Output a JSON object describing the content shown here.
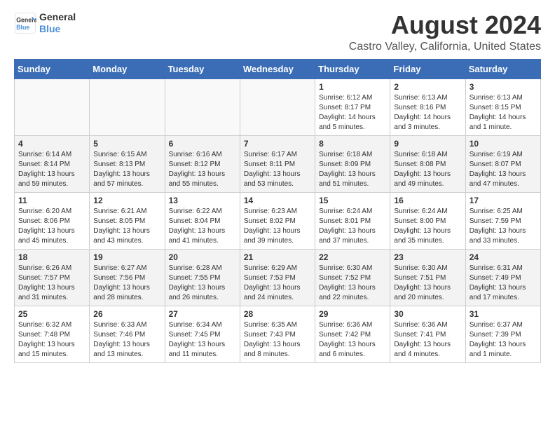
{
  "logo": {
    "line1": "General",
    "line2": "Blue"
  },
  "title": "August 2024",
  "location": "Castro Valley, California, United States",
  "weekdays": [
    "Sunday",
    "Monday",
    "Tuesday",
    "Wednesday",
    "Thursday",
    "Friday",
    "Saturday"
  ],
  "weeks": [
    [
      {
        "day": "",
        "info": ""
      },
      {
        "day": "",
        "info": ""
      },
      {
        "day": "",
        "info": ""
      },
      {
        "day": "",
        "info": ""
      },
      {
        "day": "1",
        "info": "Sunrise: 6:12 AM\nSunset: 8:17 PM\nDaylight: 14 hours\nand 5 minutes."
      },
      {
        "day": "2",
        "info": "Sunrise: 6:13 AM\nSunset: 8:16 PM\nDaylight: 14 hours\nand 3 minutes."
      },
      {
        "day": "3",
        "info": "Sunrise: 6:13 AM\nSunset: 8:15 PM\nDaylight: 14 hours\nand 1 minute."
      }
    ],
    [
      {
        "day": "4",
        "info": "Sunrise: 6:14 AM\nSunset: 8:14 PM\nDaylight: 13 hours\nand 59 minutes."
      },
      {
        "day": "5",
        "info": "Sunrise: 6:15 AM\nSunset: 8:13 PM\nDaylight: 13 hours\nand 57 minutes."
      },
      {
        "day": "6",
        "info": "Sunrise: 6:16 AM\nSunset: 8:12 PM\nDaylight: 13 hours\nand 55 minutes."
      },
      {
        "day": "7",
        "info": "Sunrise: 6:17 AM\nSunset: 8:11 PM\nDaylight: 13 hours\nand 53 minutes."
      },
      {
        "day": "8",
        "info": "Sunrise: 6:18 AM\nSunset: 8:09 PM\nDaylight: 13 hours\nand 51 minutes."
      },
      {
        "day": "9",
        "info": "Sunrise: 6:18 AM\nSunset: 8:08 PM\nDaylight: 13 hours\nand 49 minutes."
      },
      {
        "day": "10",
        "info": "Sunrise: 6:19 AM\nSunset: 8:07 PM\nDaylight: 13 hours\nand 47 minutes."
      }
    ],
    [
      {
        "day": "11",
        "info": "Sunrise: 6:20 AM\nSunset: 8:06 PM\nDaylight: 13 hours\nand 45 minutes."
      },
      {
        "day": "12",
        "info": "Sunrise: 6:21 AM\nSunset: 8:05 PM\nDaylight: 13 hours\nand 43 minutes."
      },
      {
        "day": "13",
        "info": "Sunrise: 6:22 AM\nSunset: 8:04 PM\nDaylight: 13 hours\nand 41 minutes."
      },
      {
        "day": "14",
        "info": "Sunrise: 6:23 AM\nSunset: 8:02 PM\nDaylight: 13 hours\nand 39 minutes."
      },
      {
        "day": "15",
        "info": "Sunrise: 6:24 AM\nSunset: 8:01 PM\nDaylight: 13 hours\nand 37 minutes."
      },
      {
        "day": "16",
        "info": "Sunrise: 6:24 AM\nSunset: 8:00 PM\nDaylight: 13 hours\nand 35 minutes."
      },
      {
        "day": "17",
        "info": "Sunrise: 6:25 AM\nSunset: 7:59 PM\nDaylight: 13 hours\nand 33 minutes."
      }
    ],
    [
      {
        "day": "18",
        "info": "Sunrise: 6:26 AM\nSunset: 7:57 PM\nDaylight: 13 hours\nand 31 minutes."
      },
      {
        "day": "19",
        "info": "Sunrise: 6:27 AM\nSunset: 7:56 PM\nDaylight: 13 hours\nand 28 minutes."
      },
      {
        "day": "20",
        "info": "Sunrise: 6:28 AM\nSunset: 7:55 PM\nDaylight: 13 hours\nand 26 minutes."
      },
      {
        "day": "21",
        "info": "Sunrise: 6:29 AM\nSunset: 7:53 PM\nDaylight: 13 hours\nand 24 minutes."
      },
      {
        "day": "22",
        "info": "Sunrise: 6:30 AM\nSunset: 7:52 PM\nDaylight: 13 hours\nand 22 minutes."
      },
      {
        "day": "23",
        "info": "Sunrise: 6:30 AM\nSunset: 7:51 PM\nDaylight: 13 hours\nand 20 minutes."
      },
      {
        "day": "24",
        "info": "Sunrise: 6:31 AM\nSunset: 7:49 PM\nDaylight: 13 hours\nand 17 minutes."
      }
    ],
    [
      {
        "day": "25",
        "info": "Sunrise: 6:32 AM\nSunset: 7:48 PM\nDaylight: 13 hours\nand 15 minutes."
      },
      {
        "day": "26",
        "info": "Sunrise: 6:33 AM\nSunset: 7:46 PM\nDaylight: 13 hours\nand 13 minutes."
      },
      {
        "day": "27",
        "info": "Sunrise: 6:34 AM\nSunset: 7:45 PM\nDaylight: 13 hours\nand 11 minutes."
      },
      {
        "day": "28",
        "info": "Sunrise: 6:35 AM\nSunset: 7:43 PM\nDaylight: 13 hours\nand 8 minutes."
      },
      {
        "day": "29",
        "info": "Sunrise: 6:36 AM\nSunset: 7:42 PM\nDaylight: 13 hours\nand 6 minutes."
      },
      {
        "day": "30",
        "info": "Sunrise: 6:36 AM\nSunset: 7:41 PM\nDaylight: 13 hours\nand 4 minutes."
      },
      {
        "day": "31",
        "info": "Sunrise: 6:37 AM\nSunset: 7:39 PM\nDaylight: 13 hours\nand 1 minute."
      }
    ]
  ]
}
